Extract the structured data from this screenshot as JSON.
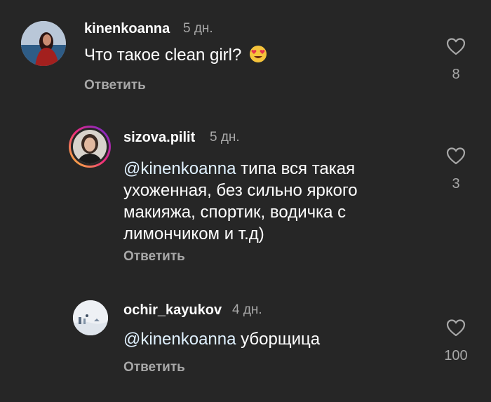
{
  "comments": [
    {
      "username": "kinenkoanna",
      "time": "5 дн.",
      "text": "Что такое clean girl?",
      "emoji": "heart-eyes-emoji",
      "reply_label": "Ответить",
      "likes": "8"
    },
    {
      "username": "sizova.pilit",
      "time": "5 дн.",
      "mention": "@kinenkoanna",
      "lines": [
        " типа вся такая",
        "ухоженная, без сильно яркого",
        "макияжа, спортик, водичка с",
        "лимончиком и т.д)"
      ],
      "reply_label": "Ответить",
      "likes": "3"
    },
    {
      "username": "ochir_kayukov",
      "time": "4 дн.",
      "mention": "@kinenkoanna",
      "text": " уборщица",
      "reply_label": "Ответить",
      "likes": "100"
    }
  ],
  "colors": {
    "background": "#262626",
    "secondary_text": "#a8a8a8",
    "story_ring": "#d62976"
  },
  "icons": [
    "heart-outline-icon",
    "heart-eyes-emoji"
  ]
}
